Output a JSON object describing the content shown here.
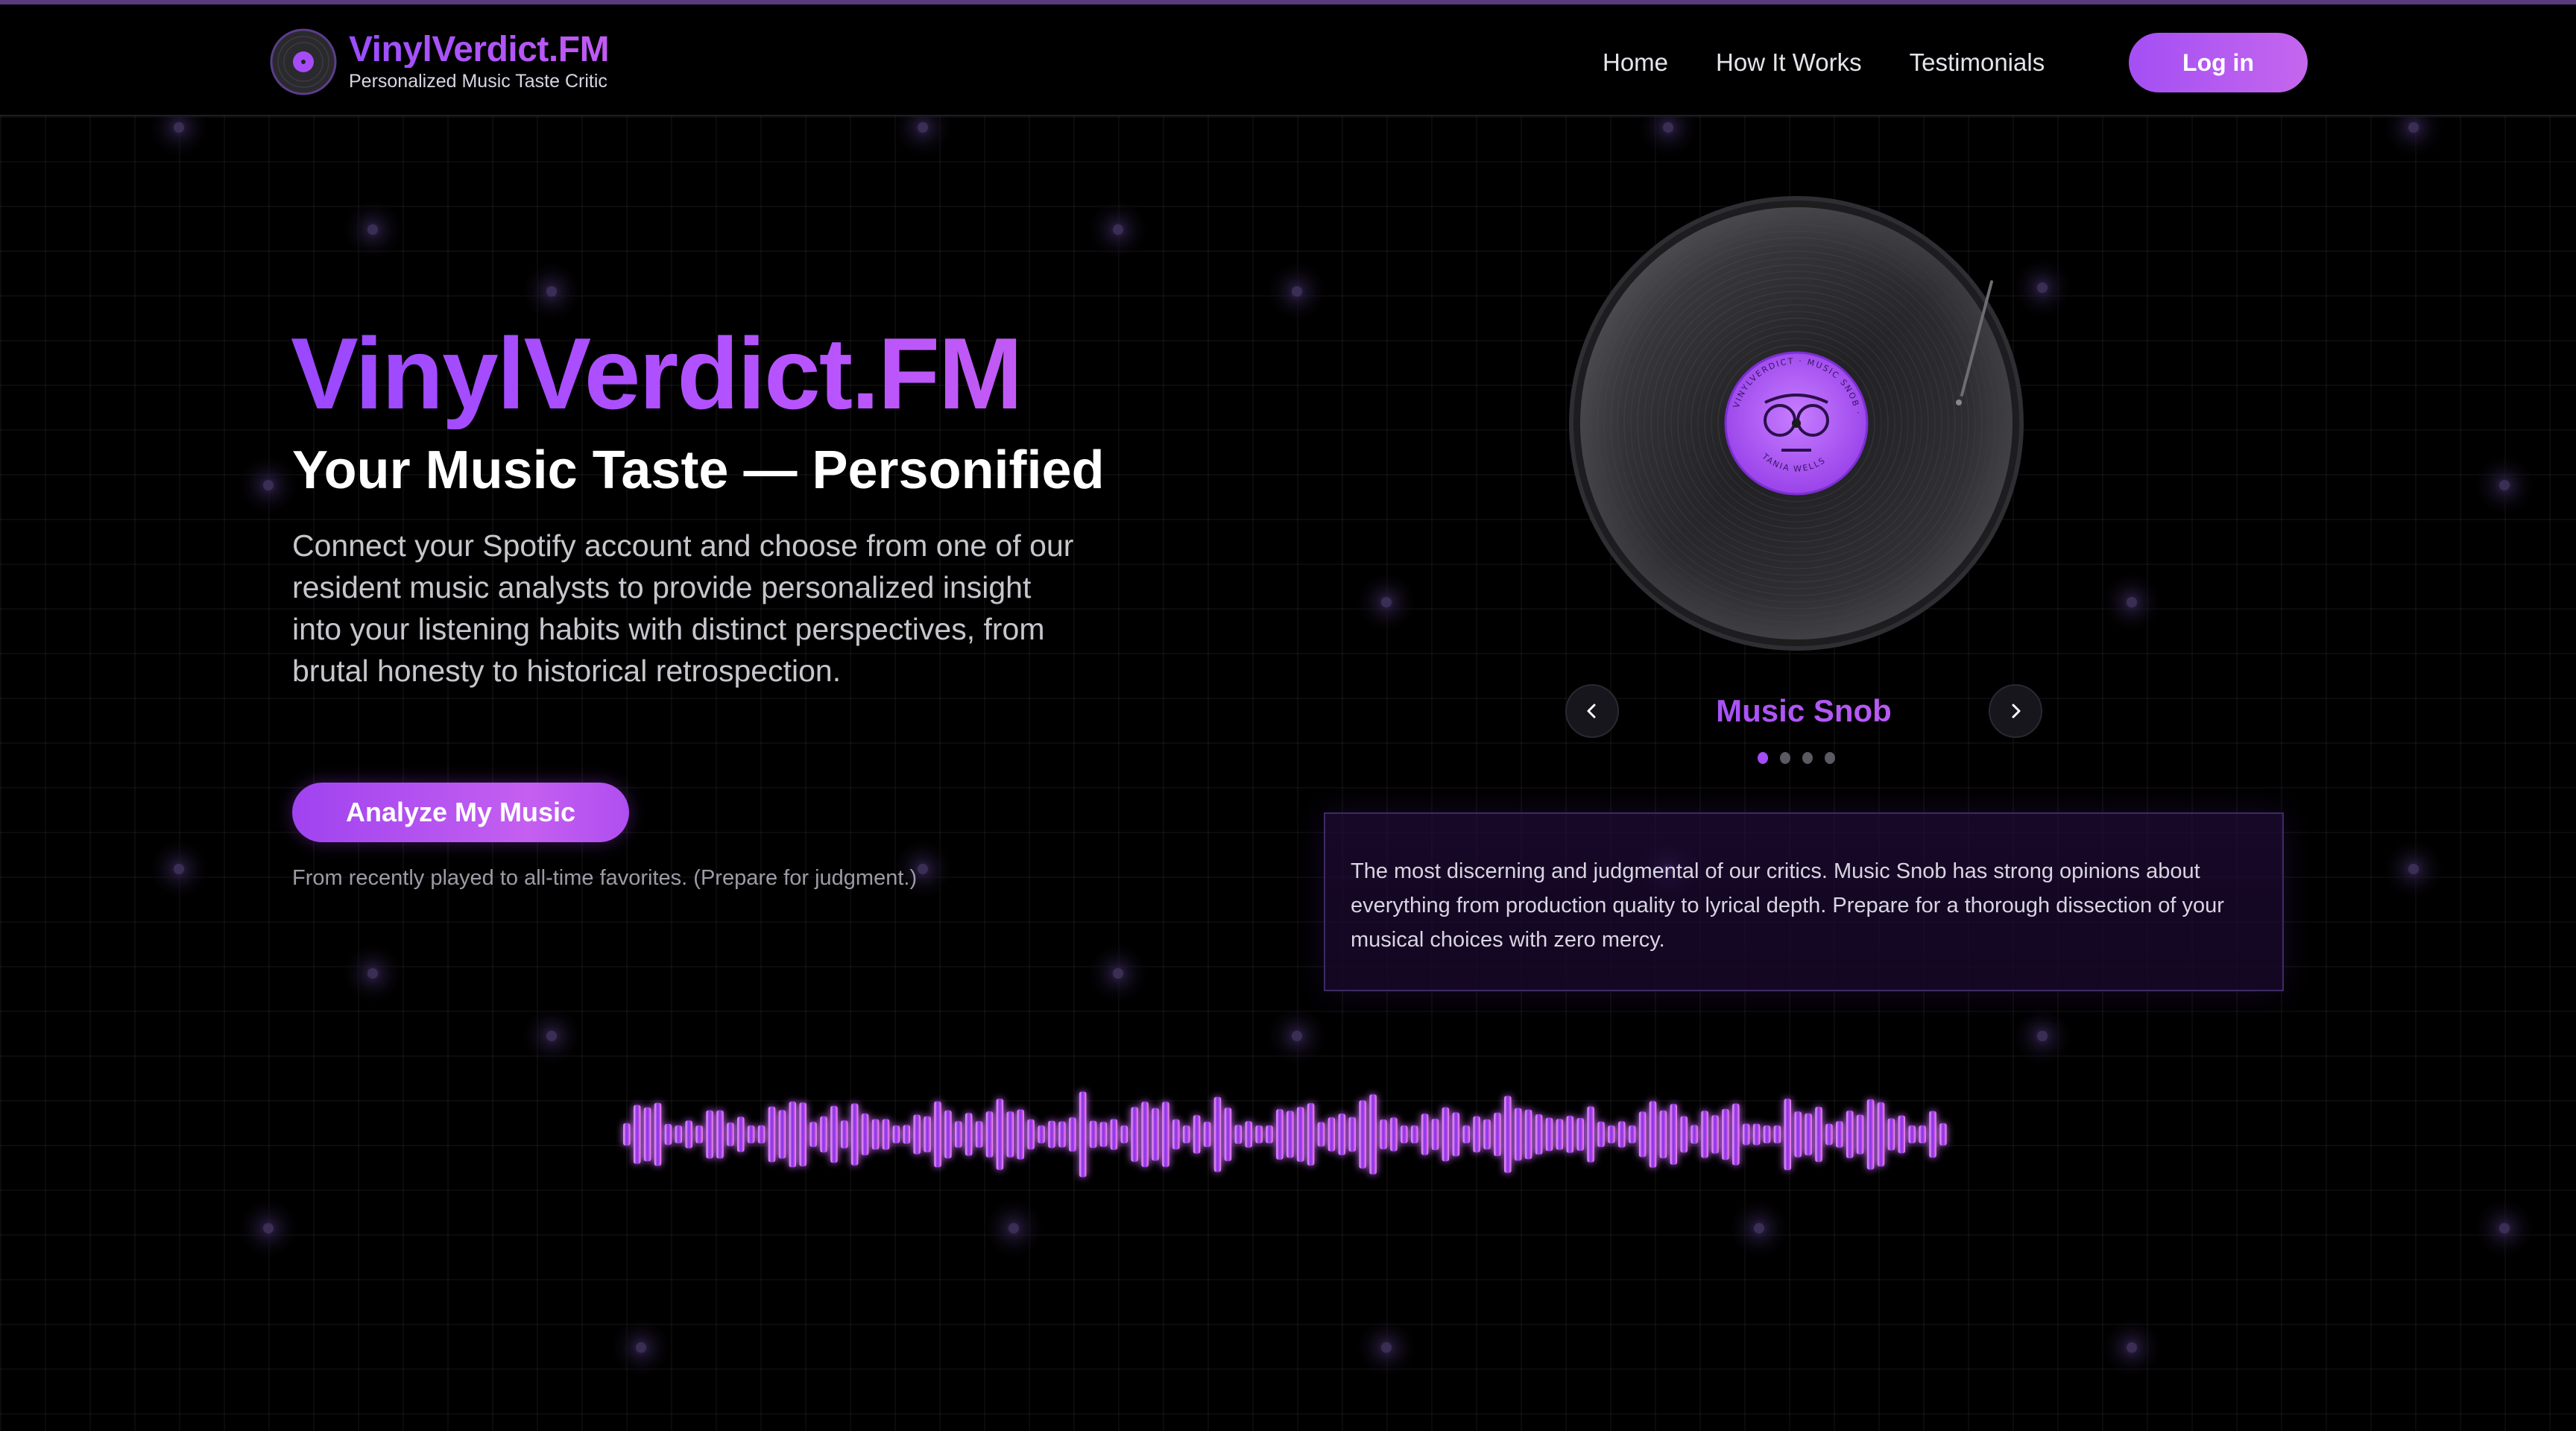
{
  "header": {
    "brand_title": "VinylVerdict.FM",
    "brand_subtitle": "Personalized Music Taste Critic",
    "nav": [
      {
        "label": "Home"
      },
      {
        "label": "How It Works"
      },
      {
        "label": "Testimonials"
      }
    ],
    "login_label": "Log in"
  },
  "hero": {
    "title": "VinylVerdict.FM",
    "subtitle": "Your Music Taste — Personified",
    "description": "Connect your Spotify account and choose from one of our resident music analysts to provide personalized insight into your listening habits with distinct perspectives, from brutal honesty to historical retrospection.",
    "cta_label": "Analyze My Music",
    "fine_print": "From recently played to all-time favorites. (Prepare for judgment.)"
  },
  "carousel": {
    "current_analyst": "Music Snob",
    "label_text": "VINYLVERDICT · MUSIC SNOB · EDITION",
    "label_text_2": "TANIA WELLS",
    "total_slides": 4,
    "active_index": 0,
    "description": "The most discerning and judgmental of our critics. Music Snob has strong opinions about everything from production quality to lyrical depth. Prepare for a thorough dissection of your musical choices with zero mercy."
  },
  "icons": {
    "prev": "chevron-left-icon",
    "next": "chevron-right-icon",
    "logo": "vinyl-record-icon"
  },
  "colors": {
    "accent": "#a64cf5",
    "accent_light": "#c566ee",
    "background": "#000000",
    "card_border": "#3e2a66",
    "wave_start": "#d86bf0",
    "wave_mid": "#8a35e8",
    "wave_end": "#e06cd0"
  }
}
